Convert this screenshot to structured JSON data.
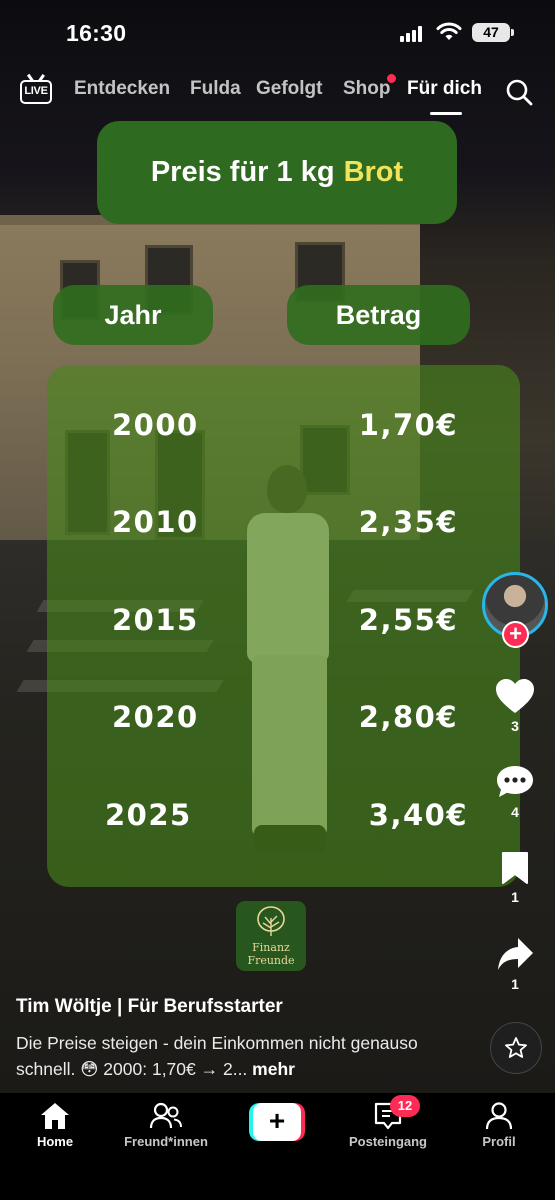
{
  "status_bar": {
    "time": "16:30",
    "battery": "47"
  },
  "top_nav": {
    "live_label": "LIVE",
    "tabs": [
      "Entdecken",
      "Fulda",
      "Gefolgt",
      "Shop",
      "Für dich"
    ],
    "active_tab": "Für dich"
  },
  "overlay": {
    "title_prefix": "Preis für 1 kg",
    "title_highlight": "Brot",
    "col_year": "Jahr",
    "col_amount": "Betrag",
    "rows": [
      {
        "year": "2000",
        "amount": "1,70€"
      },
      {
        "year": "2010",
        "amount": "2,35€"
      },
      {
        "year": "2015",
        "amount": "2,55€"
      },
      {
        "year": "2020",
        "amount": "2,80€"
      },
      {
        "year": "2025",
        "amount": "3,40€"
      }
    ],
    "logo_line1": "Finanz",
    "logo_line2": "Freunde"
  },
  "rail": {
    "likes": "3",
    "comments": "4",
    "bookmarks": "1",
    "shares": "1"
  },
  "post": {
    "author": "Tim Wöltje | Für Berufsstarter",
    "caption": "Die Preise steigen - dein Einkommen nicht genauso schnell. 😳 2000: 1,70€ → 2...",
    "more": "mehr"
  },
  "bottom_nav": {
    "home": "Home",
    "friends": "Freund*innen",
    "inbox": "Posteingang",
    "inbox_badge": "12",
    "profile": "Profil"
  },
  "colors": {
    "accent": "#fe2c55",
    "title_green": "#2e6a1f",
    "highlight_yellow": "#f2e35a",
    "avatar_ring": "#29b6e8"
  }
}
